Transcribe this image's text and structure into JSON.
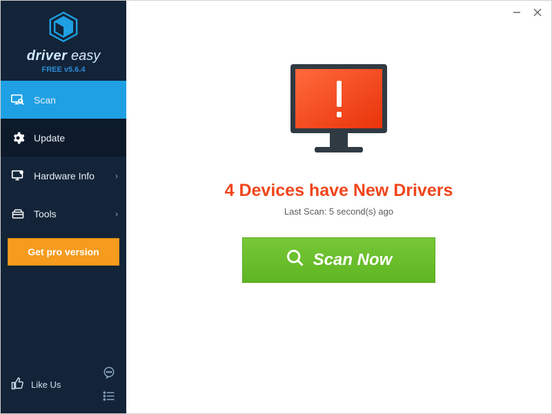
{
  "brand": {
    "name_html_part1": "driver",
    "name_html_part2": "easy",
    "version": "FREE v5.6.4"
  },
  "sidebar": {
    "items": [
      {
        "label": "Scan"
      },
      {
        "label": "Update"
      },
      {
        "label": "Hardware Info"
      },
      {
        "label": "Tools"
      }
    ],
    "get_pro": "Get pro version",
    "like_us": "Like Us"
  },
  "main": {
    "headline": "4 Devices have New Drivers",
    "subline": "Last Scan: 5 second(s) ago",
    "scan_button": "Scan Now"
  },
  "colors": {
    "accent": "#1fa0e4",
    "orange": "#f59b1e",
    "danger": "#f0451b",
    "green_top": "#77c837",
    "green_bottom": "#5eb522"
  }
}
